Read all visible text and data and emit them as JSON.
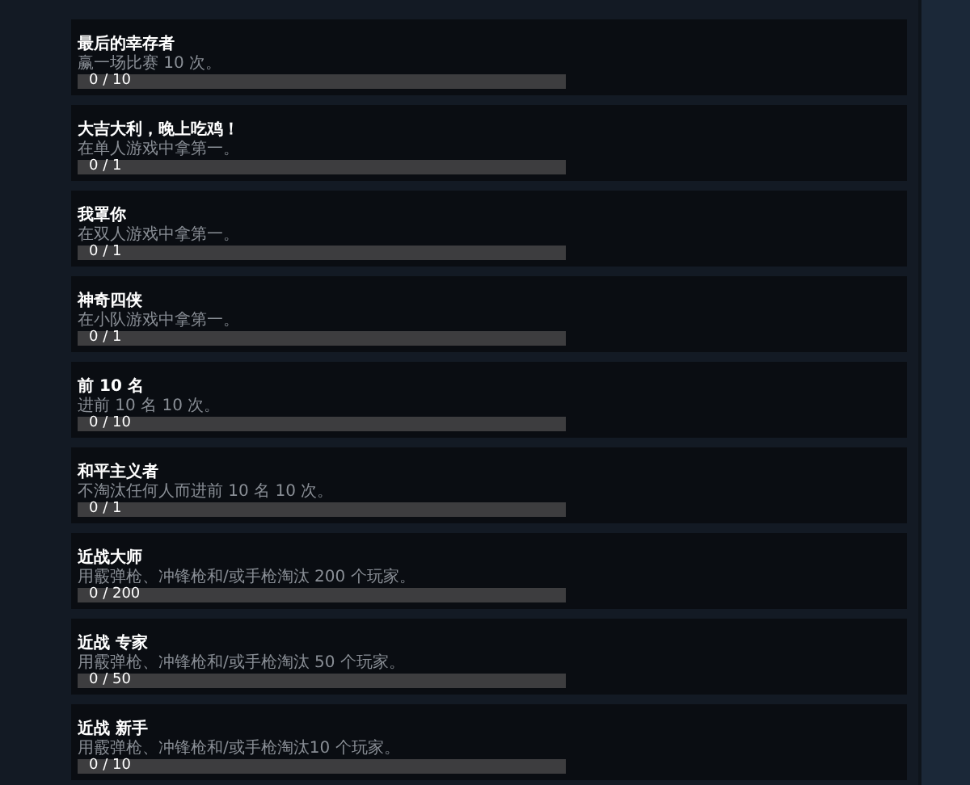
{
  "achievements": [
    {
      "title": "最后的幸存者",
      "description": "赢一场比赛 10 次。",
      "progress": "0 / 10",
      "level": 0
    },
    {
      "title": "大吉大利，晚上吃鸡！",
      "description": "在单人游戏中拿第一。",
      "progress": "0 / 1",
      "level": 0
    },
    {
      "title": "我罩你",
      "description": "在双人游戏中拿第一。",
      "progress": "0 / 1",
      "level": 0
    },
    {
      "title": "神奇四侠",
      "description": "在小队游戏中拿第一。",
      "progress": "0 / 1",
      "level": 0
    },
    {
      "title": "前 10 名",
      "description": "进前 10 名 10 次。",
      "progress": "0 / 10",
      "level": 0
    },
    {
      "title": "和平主义者",
      "description": "不淘汰任何人而进前 10 名 10 次。",
      "progress": "0 / 1",
      "level": 0
    },
    {
      "title": "近战大师",
      "description": "用霰弹枪、冲锋枪和/或手枪淘汰 200 个玩家。",
      "progress": "0 / 200",
      "level": 0
    },
    {
      "title": "近战 专家",
      "description": "用霰弹枪、冲锋枪和/或手枪淘汰 50 个玩家。",
      "progress": "0 / 50",
      "level": 0
    },
    {
      "title": "近战 新手",
      "description": "用霰弹枪、冲锋枪和/或手枪淘汰10 个玩家。",
      "progress": "0 / 10",
      "level": 0
    }
  ]
}
